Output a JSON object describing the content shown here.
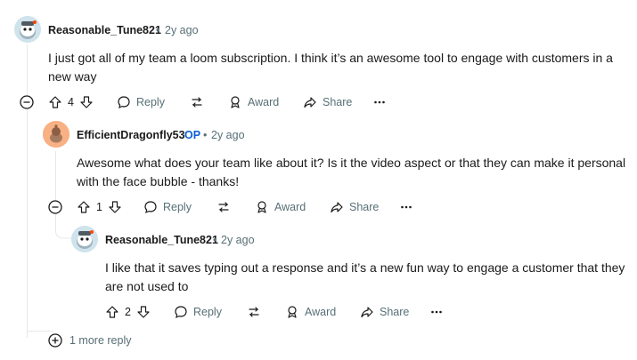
{
  "comments": [
    {
      "username": "Reasonable_Tune821",
      "age": "2y ago",
      "body": "I just got all of my team a loom subscription. I think it’s an awesome tool to engage with customers in a new way",
      "votes": "4"
    },
    {
      "username": "EfficientDragonfly53",
      "op_badge": "OP",
      "age": "2y ago",
      "body": "Awesome what does your team like about it? Is it the video aspect or that they can make it personal with the face bubble - thanks!",
      "votes": "1"
    },
    {
      "username": "Reasonable_Tune821",
      "age": "2y ago",
      "body": "I like that it saves typing out a response and it’s a new fun way to engage a customer that they are not used to",
      "votes": "2"
    }
  ],
  "actions": {
    "reply": "Reply",
    "award": "Award",
    "share": "Share",
    "separator": "•"
  },
  "more_replies": "1 more reply",
  "colors": {
    "muted": "#576f76",
    "op": "#0a5fd3",
    "line": "#e5e8ea"
  }
}
